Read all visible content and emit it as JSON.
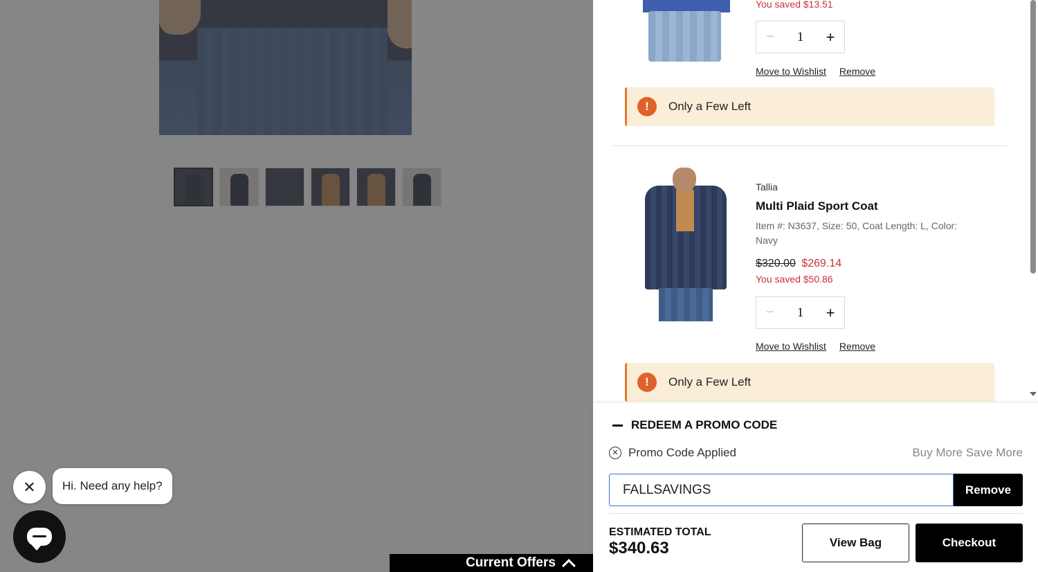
{
  "chat": {
    "greeting": "Hi. Need any help?",
    "close_glyph": "✕"
  },
  "offers_bar": {
    "label": "Current Offers"
  },
  "cart": {
    "items": [
      {
        "saved_text": "You saved $13.51",
        "quantity": "1",
        "move_to_wishlist": "Move to Wishlist",
        "remove": "Remove",
        "alert": "Only a Few Left"
      },
      {
        "brand": "Tallia",
        "name": "Multi Plaid Sport Coat",
        "meta": "Item #: N3637, Size: 50, Coat Length: L, Color: Navy",
        "original_price": "$320.00",
        "sale_price": "$269.14",
        "saved_text": "You saved $50.86",
        "quantity": "1",
        "move_to_wishlist": "Move to Wishlist",
        "remove": "Remove",
        "alert": "Only a Few Left"
      }
    ],
    "qty_minus": "−",
    "qty_plus": "+",
    "alert_glyph": "!"
  },
  "promo": {
    "heading": "REDEEM A PROMO CODE",
    "applied_label": "Promo Code Applied",
    "applied_name": "Buy More Save More",
    "code_value": "FALLSAVINGS",
    "remove_label": "Remove",
    "clear_glyph": "✕"
  },
  "summary": {
    "estimated_label": "ESTIMATED TOTAL",
    "estimated_value": "$340.63",
    "view_bag_label": "View Bag",
    "checkout_label": "Checkout"
  },
  "colors": {
    "sale_red": "#c8303a",
    "alert_bg": "#fbeed8",
    "alert_icon": "#e0622a",
    "primary_black": "#000000"
  }
}
